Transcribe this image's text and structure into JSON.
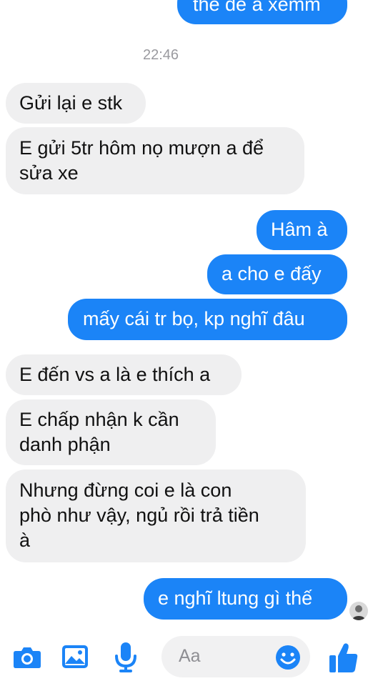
{
  "timestamp": "22:46",
  "messages": [
    {
      "dir": "out",
      "text": "thế để a xemm"
    },
    {
      "dir": "in",
      "text": "Gửi lại e stk"
    },
    {
      "dir": "in",
      "lines": [
        "E gửi 5tr hôm nọ mượn a để",
        "sửa xe"
      ]
    },
    {
      "dir": "out",
      "text": "Hâm à"
    },
    {
      "dir": "out",
      "text": "a cho e đấy"
    },
    {
      "dir": "out",
      "text": "mấy cái tr bọ, kp nghĩ đâu"
    },
    {
      "dir": "in",
      "text": "E đến vs a là e thích a"
    },
    {
      "dir": "in",
      "lines": [
        "E chấp nhận k cần",
        "danh phận"
      ]
    },
    {
      "dir": "in",
      "lines": [
        "Nhưng đừng coi e là con",
        "phò như vậy, ngủ rồi trả tiền",
        "à"
      ]
    },
    {
      "dir": "out",
      "text": "e nghĩ ltung gì thế"
    }
  ],
  "composer": {
    "placeholder": "Aa",
    "icons": [
      "camera-icon",
      "image-icon",
      "microphone-icon",
      "emoji-icon",
      "like-icon"
    ]
  },
  "colors": {
    "outgoing": "#1b84f7",
    "incoming": "#efeff0",
    "accent": "#1b84f7"
  }
}
